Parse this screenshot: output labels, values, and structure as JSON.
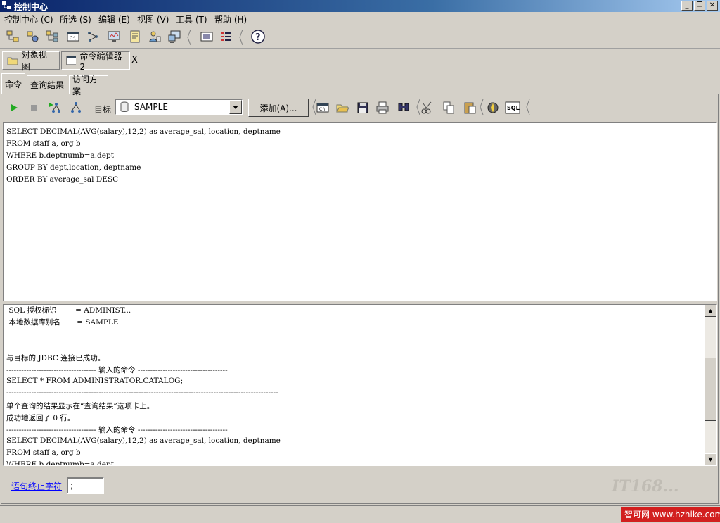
{
  "window": {
    "title": "控制中心"
  },
  "menubar": [
    {
      "label": "控制中心 (C)"
    },
    {
      "label": "所选 (S)"
    },
    {
      "label": "编辑 (E)"
    },
    {
      "label": "视图 (V)"
    },
    {
      "label": "工具 (T)"
    },
    {
      "label": "帮助 (H)"
    }
  ],
  "toolbar_icons": [
    "system-tree-icon",
    "instance-icon",
    "database-tree-icon",
    "command-editor-icon",
    "network-icon",
    "monitor-icon",
    "journal-icon",
    "user-icon",
    "remote-icon",
    "show-hide-icon",
    "list-icon",
    "help-icon"
  ],
  "view_tabs": [
    {
      "label": "对象视图"
    },
    {
      "label": "命令编辑器 2"
    }
  ],
  "close_tab": "X",
  "inner_tabs": [
    {
      "label": "命令"
    },
    {
      "label": "查询结果"
    },
    {
      "label": "访问方案"
    }
  ],
  "command_toolbar": {
    "target_label": "目标",
    "target_value": "SAMPLE",
    "add_button": "添加(A)..."
  },
  "editor_lines": [
    "SELECT DECIMAL(AVG(salary),12,2) as average_sal, location, deptname",
    "FROM staff a, org b",
    "WHERE b.deptnumb=a.dept",
    "GROUP BY dept,location, deptname",
    "ORDER BY average_sal DESC"
  ],
  "output_lines": [
    " SQL 授权标识        = ADMINIST...",
    " 本地数据库别名       = SAMPLE",
    "",
    "",
    "与目标的 JDBC 连接已成功。",
    "------------------------------------ 输入的命令 ------------------------------------",
    "SELECT * FROM ADMINISTRATOR.CATALOG;",
    "-------------------------------------------------------------------------------------------------------------",
    "单个查询的结果显示在“查询结果”选项卡上。",
    "成功地返回了 0 行。",
    "------------------------------------ 输入的命令 ------------------------------------",
    "SELECT DECIMAL(AVG(salary),12,2) as average_sal, location, deptname",
    "FROM staff a, org b",
    "WHERE b.deptnumb=a.dept"
  ],
  "terminator": {
    "label": "语句终止字符",
    "value": ";"
  },
  "watermark": "IT168...",
  "footer_logo": "智可网 www.hzhike.com"
}
